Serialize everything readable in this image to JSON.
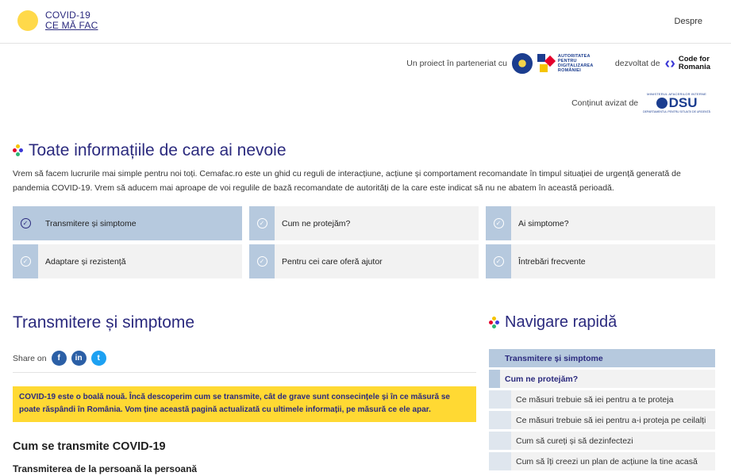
{
  "header": {
    "logo_line1": "COVID-19",
    "logo_line2": "CE MĂ FAC",
    "nav_about": "Despre"
  },
  "partners": {
    "partnership_text": "Un proiect în parteneriat cu",
    "adr_text": "AUTORITATEA PENTRU DIGITALIZAREA ROMÂNIEI",
    "developed_text": "dezvoltat de",
    "c4r_line1": "Code for",
    "c4r_line2": "Romania",
    "endorsed_text": "Conținut avizat de",
    "dsu_top": "MINISTERUL AFACERILOR INTERNE",
    "dsu_word": "DSU",
    "dsu_bottom": "DEPARTAMENTUL PENTRU SITUAȚII DE URGENȚĂ"
  },
  "main": {
    "title": "Toate informațiile de care ai nevoie",
    "intro": "Vrem să facem lucrurile mai simple pentru noi toți. Cemafac.ro este un ghid cu reguli de interacțiune, acțiune și comportament recomandate în timpul situației de urgență generată de pandemia COVID-19. Vrem să aducem mai aproape de voi regulile de bază recomandate de autorități de la care este indicat să nu ne abatem în această perioadă."
  },
  "topics": [
    {
      "label": "Transmitere și simptome",
      "active": true
    },
    {
      "label": "Cum ne protejăm?",
      "active": false
    },
    {
      "label": "Ai simptome?",
      "active": false
    },
    {
      "label": "Adaptare și rezistență",
      "active": false
    },
    {
      "label": "Pentru cei care oferă ajutor",
      "active": false
    },
    {
      "label": "Întrebări frecvente",
      "active": false
    }
  ],
  "content": {
    "section_title": "Transmitere și simptome",
    "share_label": "Share on",
    "notice": "COVID-19 este o boală nouă. Încă descoperim cum se transmite, cât de grave sunt consecințele și în ce măsură se poate răspândi în România. Vom ține această pagină actualizată cu ultimele informații, pe măsură ce ele apar.",
    "h2": "Cum se transmite COVID-19",
    "h3": "Transmiterea de la persoană la persoană"
  },
  "quick_nav": {
    "title": "Navigare rapidă",
    "items": [
      {
        "label": "Transmitere și simptome",
        "level": "head"
      },
      {
        "label": "Cum ne protejăm?",
        "level": "sub"
      },
      {
        "label": "Ce măsuri trebuie să iei pentru a te proteja",
        "level": "leaf"
      },
      {
        "label": "Ce măsuri trebuie să iei pentru a-i proteja pe ceilalți",
        "level": "leaf"
      },
      {
        "label": "Cum să cureți și să dezinfectezi",
        "level": "leaf"
      },
      {
        "label": "Cum să îți creezi un plan de acțiune la tine acasă",
        "level": "leaf"
      }
    ]
  },
  "colors": {
    "brand": "#2b2a7e",
    "accent_yellow": "#ffd933",
    "topic_blue": "#b6c9de"
  }
}
